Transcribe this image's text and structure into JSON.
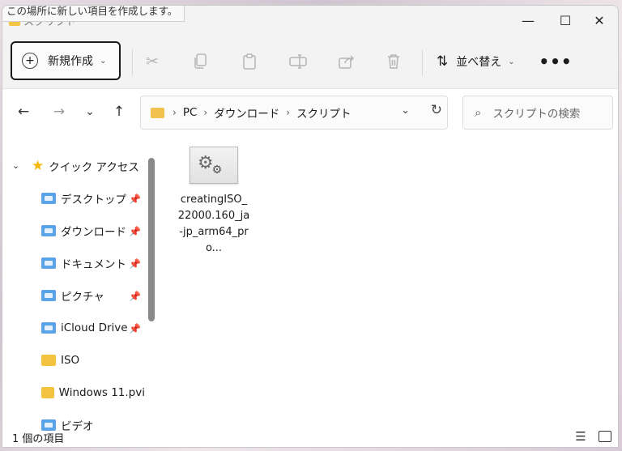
{
  "tooltip": "この場所に新しい項目を作成します。",
  "window": {
    "title": "スクリプト",
    "minimize_glyph": "—",
    "maximize_glyph": "☐",
    "close_glyph": "✕"
  },
  "toolbar": {
    "new_label": "新規作成",
    "new_icon": "plus-circle-icon",
    "cut_icon": "scissors-icon",
    "copy_icon": "copy-icon",
    "paste_icon": "clipboard-icon",
    "rename_icon": "rename-icon",
    "share_icon": "share-icon",
    "delete_icon": "trash-icon",
    "sort_label": "並べ替え",
    "sort_icon": "sort-arrows-icon",
    "more_label": "•••"
  },
  "nav": {
    "back": "←",
    "forward": "→",
    "recent": "⌄",
    "up": "↑"
  },
  "address": {
    "crumbs": [
      "PC",
      "ダウンロード",
      "スクリプト"
    ],
    "separator": "›"
  },
  "search": {
    "placeholder": "スクリプトの検索"
  },
  "sidebar": {
    "quick_access": "クイック アクセス",
    "items": [
      {
        "label": "デスクトップ",
        "color": "blue",
        "pinned": true
      },
      {
        "label": "ダウンロード",
        "color": "blue",
        "pinned": true
      },
      {
        "label": "ドキュメント",
        "color": "blue",
        "pinned": true
      },
      {
        "label": "ピクチャ",
        "color": "blue",
        "pinned": true
      },
      {
        "label": "iCloud Drive",
        "color": "blue",
        "pinned": true
      },
      {
        "label": "ISO",
        "color": "yellow",
        "pinned": false
      },
      {
        "label": "Windows 11.pvi",
        "color": "yellow",
        "pinned": false
      },
      {
        "label": "ビデオ",
        "color": "blue",
        "pinned": false
      }
    ]
  },
  "files": [
    {
      "name": "creatingISO_22000.160_ja-jp_arm64_pro...",
      "icon": "script-gear-icon"
    }
  ],
  "status": {
    "count": "1 個の項目"
  },
  "colors": {
    "accent": "#1b1b1b",
    "folder_yellow": "#f3c33f",
    "folder_blue": "#5aa3e6",
    "star": "#f5b800"
  }
}
